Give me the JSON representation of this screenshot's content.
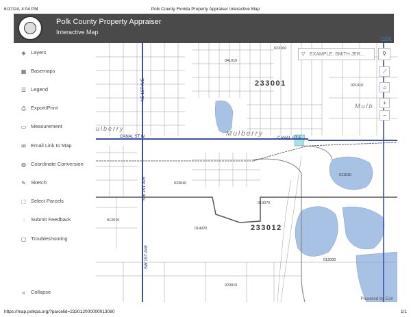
{
  "print": {
    "datetime": "6/17/24, 4:04 PM",
    "page_title": "Polk County Florida Property Appraiser Interactive Map",
    "url": "https://map.polkpa.org/?parcelid=233012000000013080",
    "page_num": "1/1"
  },
  "header": {
    "title": "Polk County Property Appraiser",
    "subtitle": "Interactive Map",
    "help": "Help"
  },
  "sidebar": {
    "items": [
      {
        "label": "Layers",
        "icon": "layers-icon"
      },
      {
        "label": "Basemaps",
        "icon": "basemaps-icon"
      },
      {
        "label": "Legend",
        "icon": "legend-icon"
      },
      {
        "label": "Export/Print",
        "icon": "print-icon"
      },
      {
        "label": "Measurement",
        "icon": "ruler-icon"
      },
      {
        "label": "Email Link to Map",
        "icon": "email-icon"
      },
      {
        "label": "Coordinate Conversion",
        "icon": "globe-icon"
      },
      {
        "label": "Sketch",
        "icon": "pencil-icon"
      },
      {
        "label": "Select Parcels",
        "icon": "select-icon"
      },
      {
        "label": "Submit Feedback",
        "icon": "feedback-icon"
      },
      {
        "label": "Troubleshooting",
        "icon": "chat-icon"
      }
    ],
    "collapse": "Collapse"
  },
  "search": {
    "placeholder": "EXAMPLE: SMITH JER..."
  },
  "map": {
    "labels": {
      "section_233001": "233001",
      "section_233012": "233012",
      "town_mulberry": "Mulberry",
      "town_mulb": "Mulb",
      "town_ulberry": "ulberry",
      "canal_w": "CANAL ST W",
      "canal_e": "CANAL ST E",
      "road_ne": "NE 1ST AVE",
      "road_sw": "SW 1ST AVE",
      "road_sw2": "SW 1ST AVE",
      "p023100": "023100",
      "p041010": "041010",
      "p021010": "021010",
      "p033040": "033040",
      "p013070": "013070",
      "p011010": "011010",
      "p012010": "012010",
      "p014020": "014020",
      "p012000": "012000",
      "p023010": "023010",
      "hwy_left": "Mulbe",
      "hwy_right": "Mulberry"
    },
    "powered_by": "Powered by Esri"
  },
  "colors": {
    "header_bg": "#4a4a4a",
    "water": "#a8c2e6",
    "highway": "#3b4fa8",
    "section_line": "#555555",
    "parcel_line": "#9a9a9a"
  }
}
